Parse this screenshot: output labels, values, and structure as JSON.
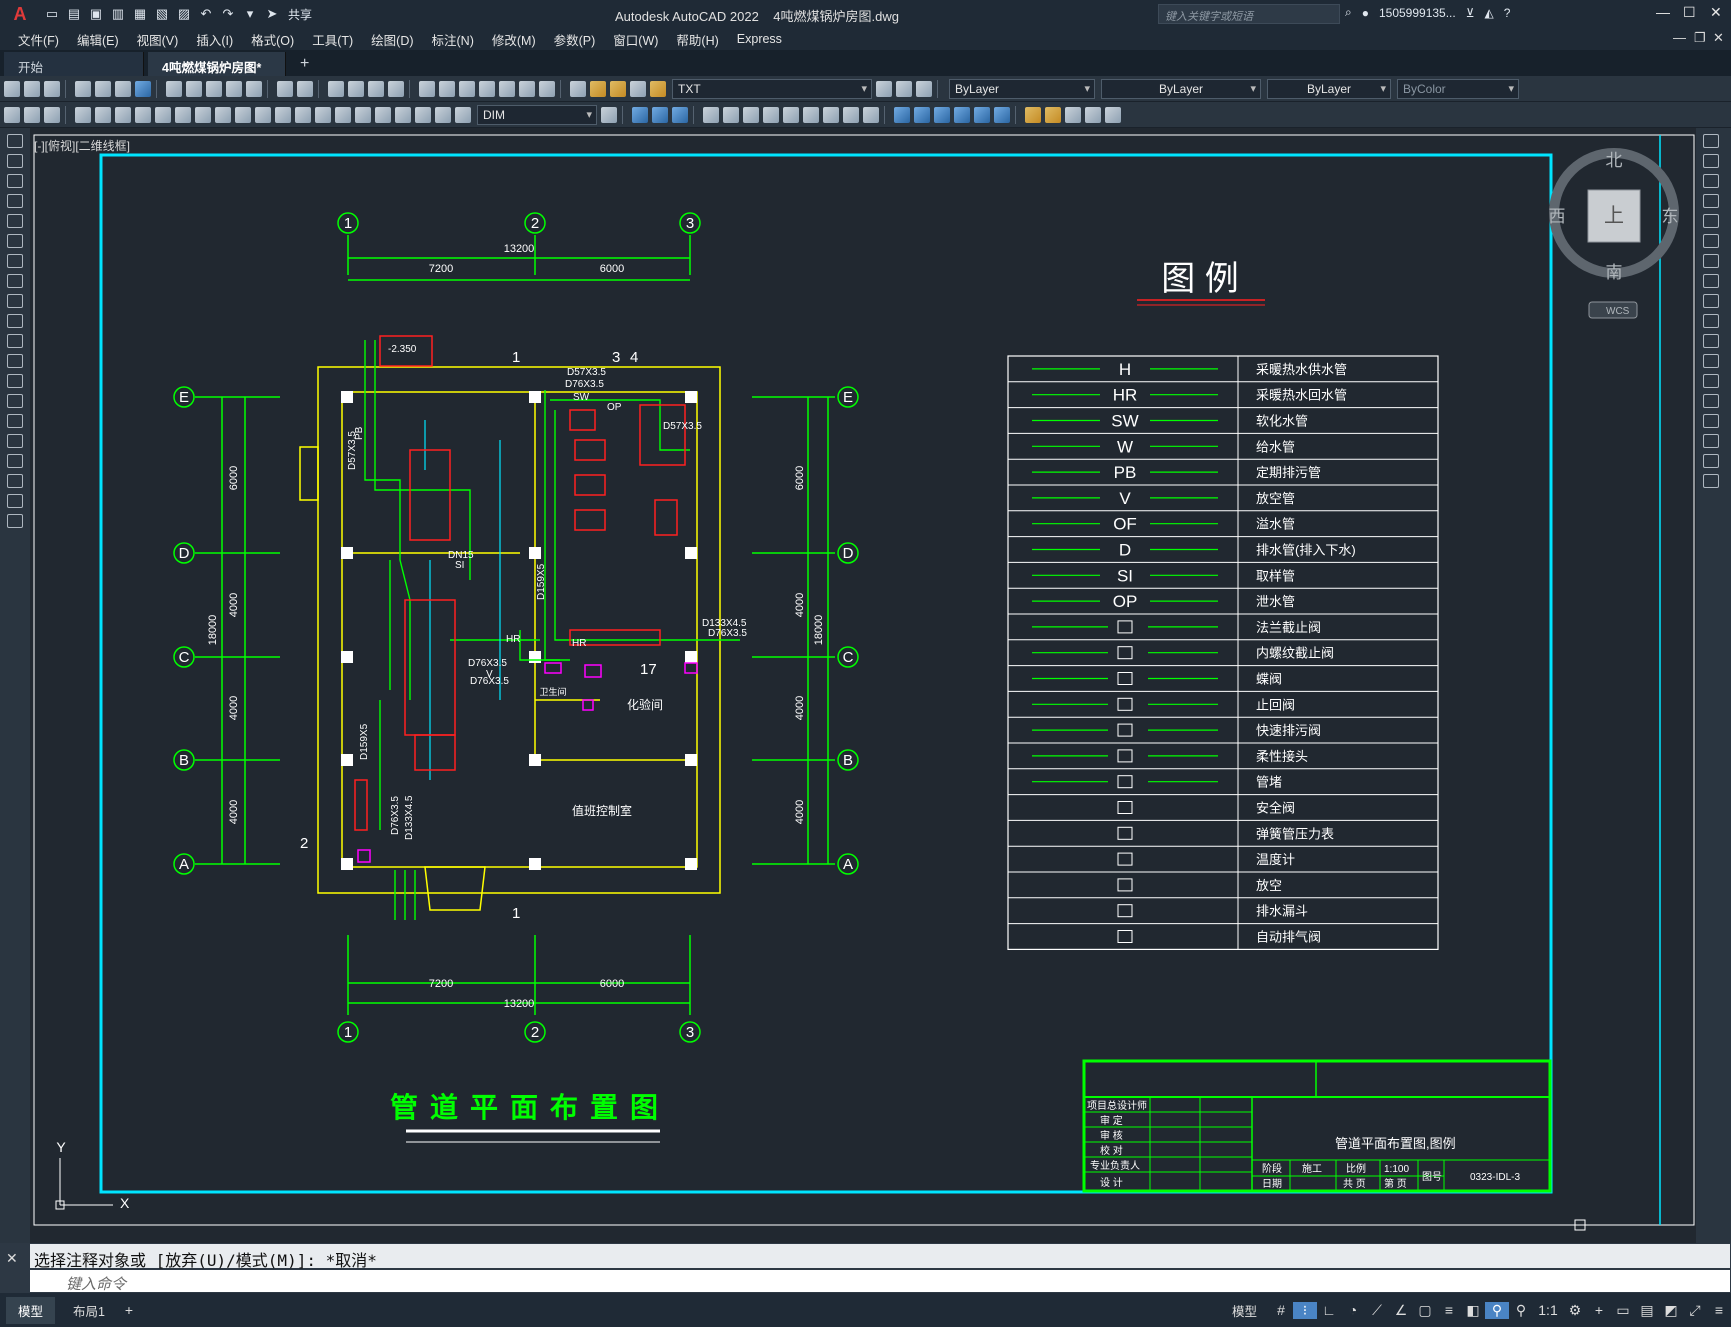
{
  "app": {
    "logo": "A",
    "title": "Autodesk AutoCAD 2022    4吨燃煤锅炉房图.dwg",
    "share": "共享",
    "search_placeholder": "键入关键字或短语",
    "user": "1505999135...",
    "window_controls": [
      "minimize-icon",
      "maximize-icon",
      "close-icon"
    ]
  },
  "menu": [
    "文件(F)",
    "编辑(E)",
    "视图(V)",
    "插入(I)",
    "格式(O)",
    "工具(T)",
    "绘图(D)",
    "标注(N)",
    "修改(M)",
    "参数(P)",
    "窗口(W)",
    "帮助(H)",
    "Express"
  ],
  "tabs": [
    {
      "label": "开始"
    },
    {
      "label": "4吨燃煤锅炉房图*"
    }
  ],
  "ribbon": {
    "layer": "TXT",
    "color": "ByLayer",
    "linetype": "ByLayer",
    "lineweight": "ByLayer",
    "plotstyle": "ByColor",
    "dimstyle": "DIM"
  },
  "viewport": {
    "label": "[-][俯视][二维线框]",
    "viewcube": {
      "n": "北",
      "s": "南",
      "e": "东",
      "w": "西",
      "face": "上",
      "wcs": "WCS"
    }
  },
  "drawing": {
    "grid_top": [
      "1",
      "2",
      "3"
    ],
    "grid_side": [
      "E",
      "D",
      "C",
      "B",
      "A"
    ],
    "dims_h": [
      "7200",
      "6000",
      "13200"
    ],
    "dims_v": [
      "6000",
      "4000",
      "4000",
      "4000"
    ],
    "dim_total_v": "18000",
    "plan_title": "管道平面布置图",
    "legend_title": "图    例",
    "legend": [
      {
        "sym": "H",
        "desc": "采暖热水供水管"
      },
      {
        "sym": "HR",
        "desc": "采暖热水回水管"
      },
      {
        "sym": "SW",
        "desc": "软化水管"
      },
      {
        "sym": "W",
        "desc": "给水管"
      },
      {
        "sym": "PB",
        "desc": "定期排污管"
      },
      {
        "sym": "V",
        "desc": "放空管"
      },
      {
        "sym": "OF",
        "desc": "溢水管"
      },
      {
        "sym": "D",
        "desc": "排水管(排入下水)"
      },
      {
        "sym": "SI",
        "desc": "取样管"
      },
      {
        "sym": "OP",
        "desc": "泄水管"
      },
      {
        "sym": "法兰截止阀",
        "desc": "法兰截止阀"
      },
      {
        "sym": "内螺纹截止阀",
        "desc": "内螺纹截止阀"
      },
      {
        "sym": "蝶阀",
        "desc": "蝶阀"
      },
      {
        "sym": "止回阀",
        "desc": "止回阀"
      },
      {
        "sym": "快速排污阀",
        "desc": "快速排污阀"
      },
      {
        "sym": "柔性接头",
        "desc": "柔性接头"
      },
      {
        "sym": "管堵",
        "desc": "管堵"
      },
      {
        "sym": "安全阀",
        "desc": "安全阀"
      },
      {
        "sym": "弹簧管压力表",
        "desc": "弹簧管压力表"
      },
      {
        "sym": "温度计",
        "desc": "温度计"
      },
      {
        "sym": "放空",
        "desc": "放空"
      },
      {
        "sym": "排水漏斗",
        "desc": "排水漏斗"
      },
      {
        "sym": "自动排气阀",
        "desc": "自动排气阀"
      }
    ],
    "room_labels": [
      "化验间",
      "值班控制室",
      "卫生间"
    ],
    "pipe_labels": [
      "D57X3.5",
      "D76X3.5",
      "D159X5",
      "D133X4.5",
      "DN15",
      "HR",
      "SW",
      "PB",
      "OP",
      "V",
      "SI",
      "-2.350"
    ],
    "section_marks": [
      "1",
      "2",
      "3",
      "4",
      "17"
    ],
    "title_block": {
      "drawing_name": "管道平面布置图,图例",
      "rows": [
        "项目总设计师",
        "审  定",
        "审  核",
        "校  对",
        "专业负责人",
        "设  计"
      ],
      "stage_label": "阶段",
      "stage": "施工",
      "scale_label": "比例",
      "scale": "1:100",
      "date_label": "日期",
      "total_label": "共 页",
      "page_label": "第 页",
      "fig_label": "图号",
      "fig_no": "0323-IDL-3"
    }
  },
  "command": {
    "history": "选择注释对象或 [放弃(U)/模式(M)]: *取消*",
    "placeholder": "键入命令"
  },
  "status": {
    "layouts": [
      "模型",
      "布局1"
    ],
    "model": "模型",
    "scale": "1:1"
  },
  "colors": {
    "border": "#00e5ff",
    "grid": "#00ff00",
    "wall": "#ffff00",
    "equip": "#ff2020",
    "legend": "#ffffff",
    "magenta": "#ff00ff"
  }
}
